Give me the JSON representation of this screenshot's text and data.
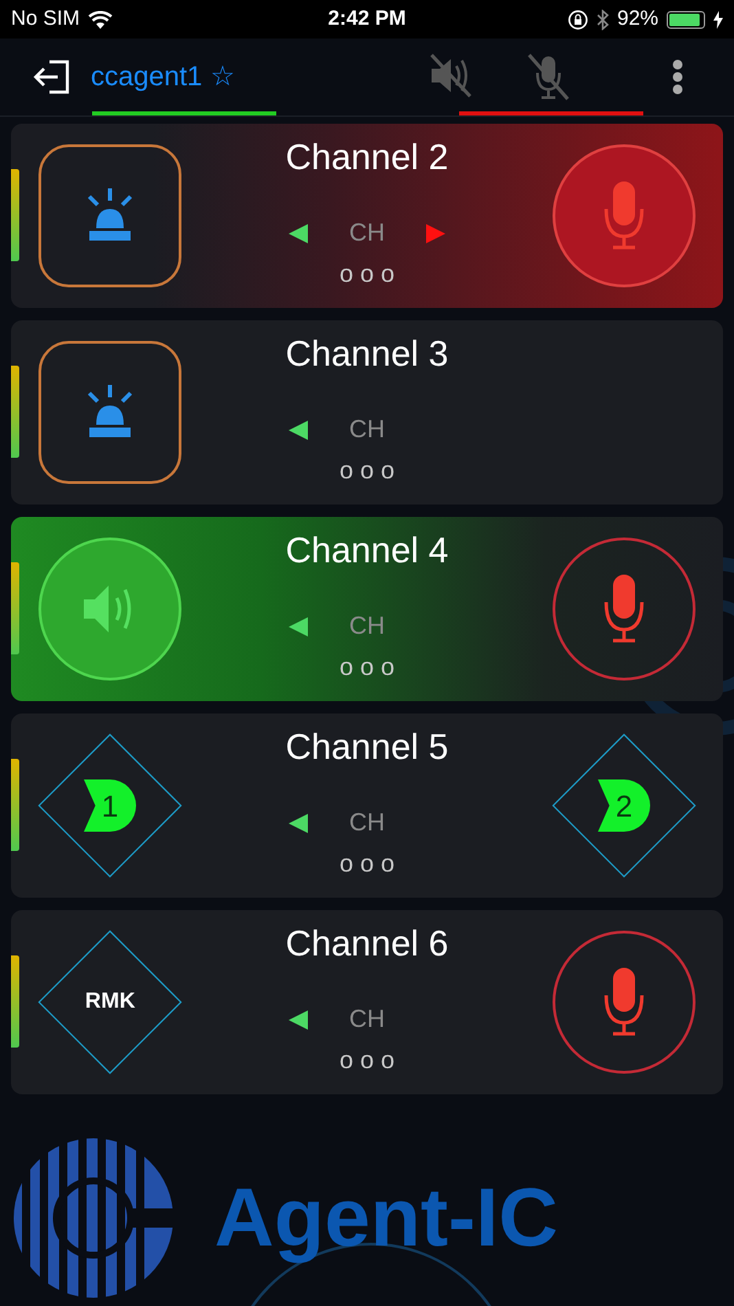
{
  "status_bar": {
    "carrier": "No SIM",
    "time": "2:42 PM",
    "battery": "92%"
  },
  "header": {
    "user": "ccagent1",
    "favorite_mark": "☆",
    "user_connected": true,
    "speaker_muted": true,
    "mic_muted": true
  },
  "channels": [
    {
      "name": "Channel 2",
      "kind": "talking",
      "left": {
        "kind": "alert"
      },
      "right": {
        "kind": "mic"
      },
      "ch_label": "CH",
      "next_arrow": true,
      "more": "o o o"
    },
    {
      "name": "Channel 3",
      "kind": "idle",
      "left": {
        "kind": "alert"
      },
      "ch_label": "CH",
      "next_arrow": false,
      "more": "o o o"
    },
    {
      "name": "Channel 4",
      "kind": "listening",
      "left": {
        "kind": "speaker"
      },
      "right": {
        "kind": "mic"
      },
      "ch_label": "CH",
      "next_arrow": false,
      "more": "o o o"
    },
    {
      "name": "Channel 5",
      "kind": "idle",
      "left": {
        "kind": "gate",
        "label": "1"
      },
      "right": {
        "kind": "gate",
        "label": "2"
      },
      "ch_label": "CH",
      "next_arrow": false,
      "more": "o o o"
    },
    {
      "name": "Channel 6",
      "kind": "idle",
      "left": {
        "kind": "remark",
        "label": "RMK"
      },
      "right": {
        "kind": "mic"
      },
      "ch_label": "CH",
      "next_arrow": false,
      "more": "o o o"
    }
  ],
  "logo": {
    "text": "Agent-IC"
  }
}
